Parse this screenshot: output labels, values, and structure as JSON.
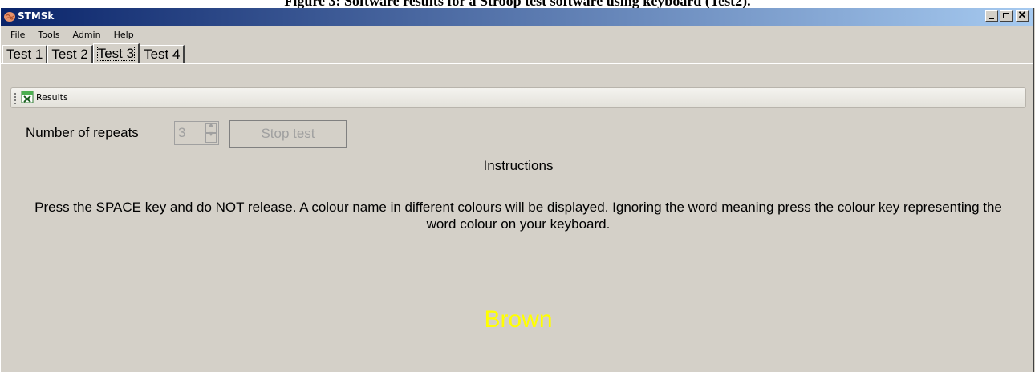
{
  "caption": "Figure 3: Software results for a Stroop test software using keyboard (Test2).",
  "window": {
    "title": "STMSk"
  },
  "menu": [
    "File",
    "Tools",
    "Admin",
    "Help"
  ],
  "tabs": [
    "Test 1",
    "Test 2",
    "Test 3",
    "Test 4"
  ],
  "active_tab": "Test 3",
  "toolbar": {
    "results_label": "Results"
  },
  "form": {
    "repeats_label": "Number of repeats",
    "repeats_value": "3",
    "stop_label": "Stop test"
  },
  "instructions": {
    "title": "Instructions",
    "text": "Press the SPACE key and do NOT release. A colour name in different colours will be displayed. Ignoring the word meaning press the colour key representing the word colour on your keyboard."
  },
  "stimulus": {
    "word": "Brown",
    "color": "#ffff00"
  },
  "colors": {
    "titlebar_start": "#0a246a",
    "titlebar_end": "#a6caf0",
    "window_bg": "#d4d0c8"
  }
}
